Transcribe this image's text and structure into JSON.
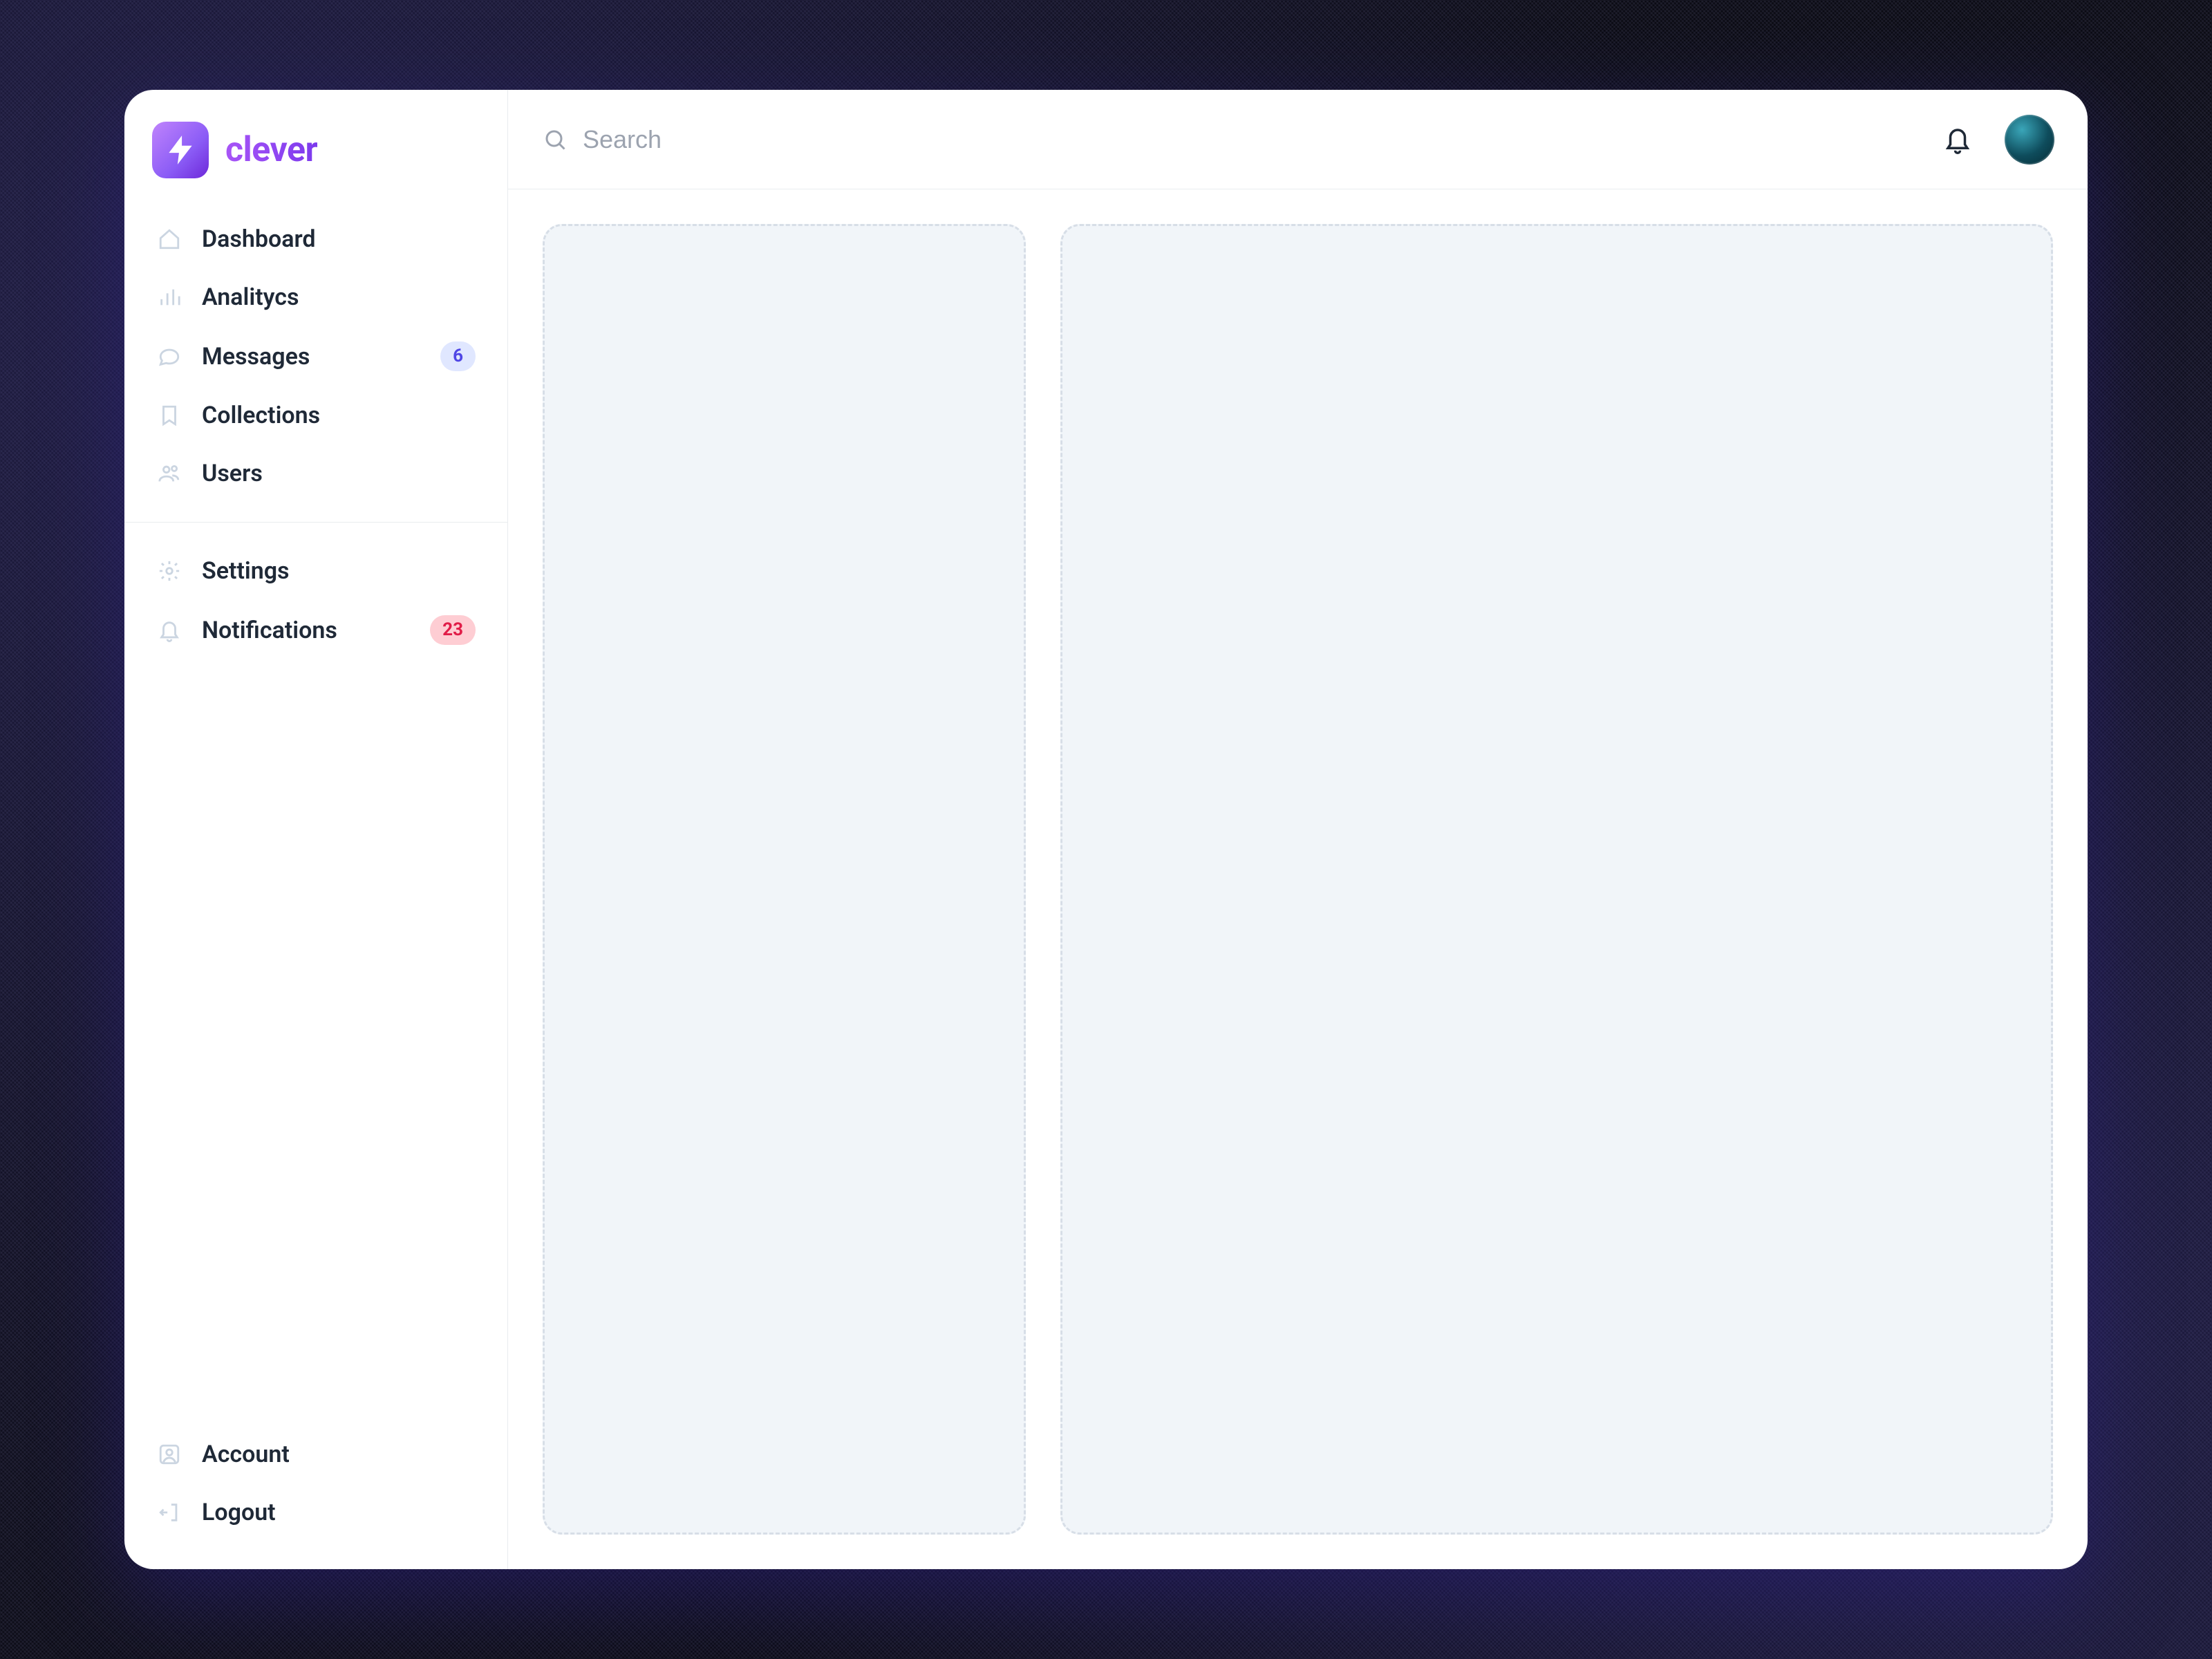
{
  "brand": {
    "name": "clever"
  },
  "search": {
    "placeholder": "Search"
  },
  "sidebar": {
    "primary": [
      {
        "label": "Dashboard"
      },
      {
        "label": "Analitycs"
      },
      {
        "label": "Messages",
        "badge": "6",
        "badge_variant": "primary"
      },
      {
        "label": "Collections"
      },
      {
        "label": "Users"
      }
    ],
    "secondary": [
      {
        "label": "Settings"
      },
      {
        "label": "Notifications",
        "badge": "23",
        "badge_variant": "danger"
      }
    ],
    "bottom": [
      {
        "label": "Account"
      },
      {
        "label": "Logout"
      }
    ]
  }
}
